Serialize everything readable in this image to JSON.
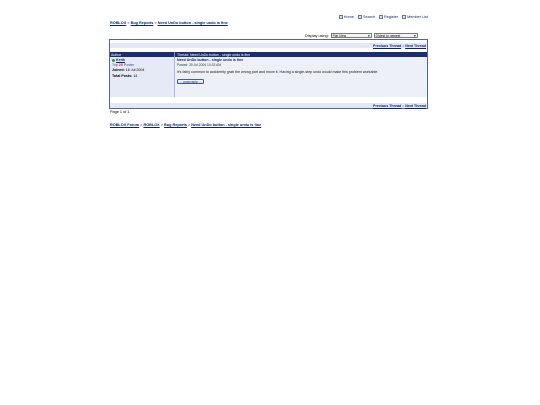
{
  "topnav": {
    "home": "Home",
    "search": "Search",
    "register": "Register",
    "member_list": "Member List"
  },
  "breadcrumb_top": {
    "forum": "ROBLOX",
    "sep": ">",
    "section": "Bug Reports",
    "thread": "Need UnDo button - single undo is fine"
  },
  "display": {
    "label": "Display using:",
    "view": "Flat View",
    "order": "Oldest to newest"
  },
  "threadnav": {
    "prev": "Previous Thread",
    "sep": "::",
    "next": "Next Thread"
  },
  "table": {
    "author_header": "Author",
    "thread_header": "Thread: Need UnDo button - single undo is fine"
  },
  "post": {
    "author": "Keith",
    "top_label": "Top",
    "rank_number": "25",
    "rank_label": "Poster",
    "joined_label": "Joined:",
    "joined_value": "16 Jul 2004",
    "total_label": "Total Posts:",
    "total_value": "14",
    "subject": "Need UnDo button - single undo is fine",
    "posted": "Posted: 30 Jul 2004 10:33 AM",
    "body": "It's fairly common to accidently grab the wrong part and move it. Having a single-step undo would make this problem workable.",
    "reply_label": "post reply"
  },
  "pageinfo": "Page 1 of 1",
  "breadcrumb_bottom": {
    "root": "ROBLOX Forum",
    "sep": ">",
    "forum": "ROBLOX",
    "section": "Bug Reports",
    "thread": "Need UnDo button - single undo is fine"
  }
}
